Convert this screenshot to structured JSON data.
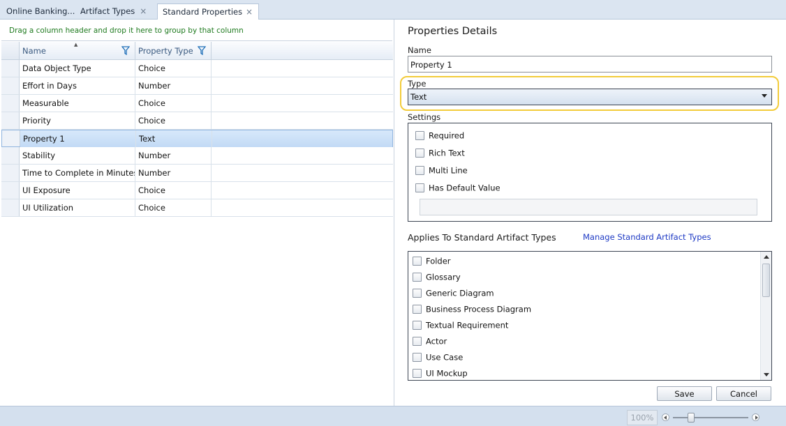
{
  "tabs": [
    {
      "label": "Online Banking..."
    },
    {
      "label": "Artifact Types"
    },
    {
      "label": "Standard Properties"
    }
  ],
  "close_glyph": "×",
  "grid": {
    "group_hint": "Drag a column header and drop it here to group by that column",
    "columns": [
      "Name",
      "Property Type"
    ],
    "rows": [
      {
        "name": "Data Object Type",
        "type": "Choice"
      },
      {
        "name": "Effort in Days",
        "type": "Number"
      },
      {
        "name": "Measurable",
        "type": "Choice"
      },
      {
        "name": "Priority",
        "type": "Choice"
      },
      {
        "name": "Property 1",
        "type": "Text"
      },
      {
        "name": "Stability",
        "type": "Number"
      },
      {
        "name": "Time to Complete in Minutes",
        "type": "Number"
      },
      {
        "name": "UI Exposure",
        "type": "Choice"
      },
      {
        "name": "UI Utilization",
        "type": "Choice"
      }
    ],
    "selected_row": "Property 1"
  },
  "details": {
    "title": "Properties Details",
    "name_label": "Name",
    "name_value": "Property 1",
    "type_label": "Type",
    "type_value": "Text",
    "settings_label": "Settings",
    "settings": [
      "Required",
      "Rich Text",
      "Multi Line",
      "Has Default Value"
    ],
    "applies_label": "Applies To Standard Artifact Types",
    "manage_link": "Manage Standard Artifact Types",
    "artifact_types": [
      "Folder",
      "Glossary",
      "Generic Diagram",
      "Business Process Diagram",
      "Textual Requirement",
      "Actor",
      "Use Case",
      "UI Mockup"
    ],
    "save": "Save",
    "cancel": "Cancel"
  },
  "statusbar": {
    "zoom": "100%"
  },
  "colors": {
    "highlight": "#f3cc3a",
    "link": "#1d39c4",
    "hint": "#1e7a1e"
  }
}
